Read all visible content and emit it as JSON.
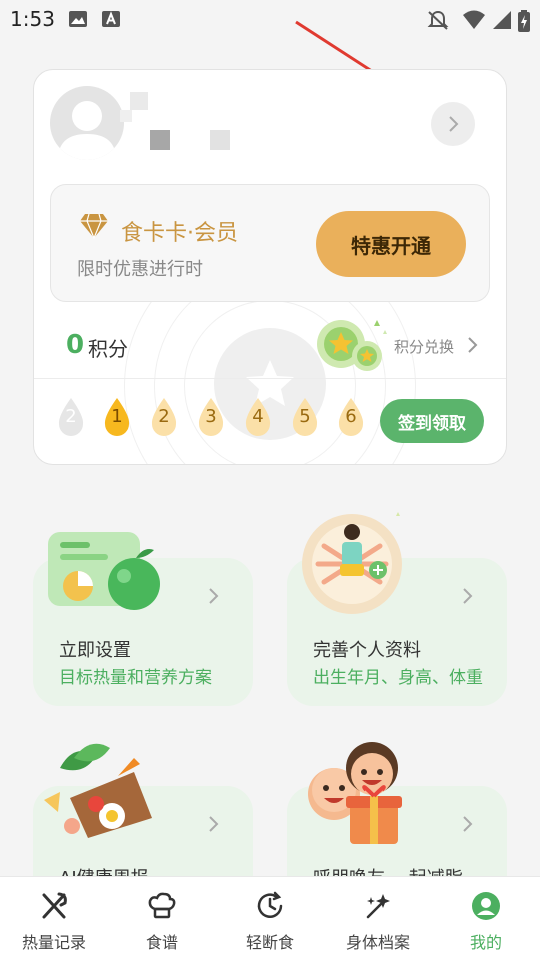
{
  "status_bar": {
    "time": "1:53"
  },
  "profile": {
    "member": {
      "title": "食卡卡·会员",
      "subtitle": "限时优惠进行时",
      "button_label": "特惠开通"
    },
    "points": {
      "value": "0",
      "label": "积分",
      "exchange_label": "积分兑换"
    },
    "checkin": {
      "days": [
        "2",
        "1",
        "2",
        "3",
        "4",
        "5",
        "6"
      ],
      "button_label": "签到领取"
    }
  },
  "features": [
    {
      "title": "立即设置",
      "subtitle": "目标热量和营养方案"
    },
    {
      "title": "完善个人资料",
      "subtitle": "出生年月、身高、体重"
    },
    {
      "title": "AI健康周报",
      "subtitle": ""
    },
    {
      "title": "呼朋唤友 一起减脂",
      "subtitle": ""
    }
  ],
  "bottom_nav": [
    {
      "label": "热量记录",
      "icon": "fork-knife-icon"
    },
    {
      "label": "食谱",
      "icon": "chef-hat-icon"
    },
    {
      "label": "轻断食",
      "icon": "clock-icon"
    },
    {
      "label": "身体档案",
      "icon": "sparkle-icon"
    },
    {
      "label": "我的",
      "icon": "user-icon",
      "active": true
    }
  ],
  "colors": {
    "accent_green": "#4caf60",
    "gold": "#eab05b",
    "member_gold": "#c99541"
  }
}
